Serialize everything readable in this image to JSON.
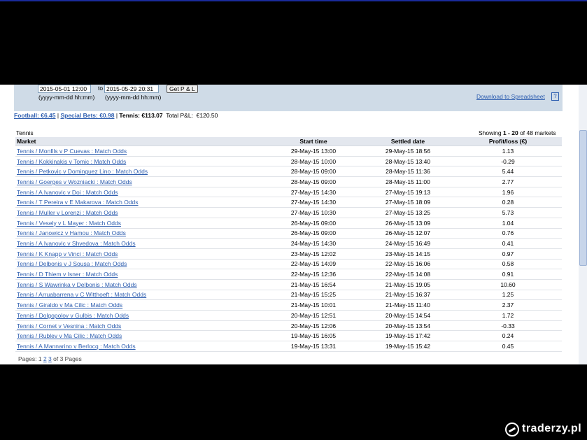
{
  "filter": {
    "from_value": "2015-05-01 12:00",
    "to_label": "to",
    "to_value": "2015-05-29 20:31",
    "from_hint": "(yyyy-mm-dd hh:mm)",
    "to_hint": "(yyyy-mm-dd hh:mm)",
    "get_pl_label": "Get P & L",
    "download_label": "Download to Spreadsheet",
    "help_label": "?"
  },
  "totals": {
    "football": "Football: €6.45",
    "sep1": " | ",
    "special": "Special Bets: €0.98",
    "sep2": " | ",
    "tennis": "Tennis: €113.07",
    "total": "  Total P&L:  €120.50"
  },
  "section_title": "Tennis",
  "showing": {
    "prefix": "Showing ",
    "range": "1 - 20",
    "suffix": " of 48 markets"
  },
  "table": {
    "headers": {
      "market": "Market",
      "start": "Start time",
      "settled": "Settled date",
      "pl": "Profit/loss (€)"
    },
    "rows": [
      {
        "market": "Tennis / Monfils v P Cuevas : Match Odds",
        "start": "29-May-15 13:00",
        "settled": "29-May-15 18:56",
        "pl": "1.13"
      },
      {
        "market": "Tennis / Kokkinakis v Tomic : Match Odds",
        "start": "28-May-15 10:00",
        "settled": "28-May-15 13:40",
        "pl": "-0.29"
      },
      {
        "market": "Tennis / Petkovic v Dominguez Lino : Match Odds",
        "start": "28-May-15 09:00",
        "settled": "28-May-15 11:36",
        "pl": "5.44"
      },
      {
        "market": "Tennis / Goerges v Wozniacki : Match Odds",
        "start": "28-May-15 09:00",
        "settled": "28-May-15 11:00",
        "pl": "2.77"
      },
      {
        "market": "Tennis / A Ivanovic v Doi : Match Odds",
        "start": "27-May-15 14:30",
        "settled": "27-May-15 19:13",
        "pl": "1.96"
      },
      {
        "market": "Tennis / T Pereira v E Makarova : Match Odds",
        "start": "27-May-15 14:30",
        "settled": "27-May-15 18:09",
        "pl": "0.28"
      },
      {
        "market": "Tennis / Muller v Lorenzi : Match Odds",
        "start": "27-May-15 10:30",
        "settled": "27-May-15 13:25",
        "pl": "5.73"
      },
      {
        "market": "Tennis / Vesely v L Mayer : Match Odds",
        "start": "26-May-15 09:00",
        "settled": "26-May-15 13:09",
        "pl": "1.04"
      },
      {
        "market": "Tennis / Janowicz v Hamou : Match Odds",
        "start": "26-May-15 09:00",
        "settled": "26-May-15 12:07",
        "pl": "0.76"
      },
      {
        "market": "Tennis / A Ivanovic v Shvedova : Match Odds",
        "start": "24-May-15 14:30",
        "settled": "24-May-15 16:49",
        "pl": "0.41"
      },
      {
        "market": "Tennis / K Knapp v Vinci : Match Odds",
        "start": "23-May-15 12:02",
        "settled": "23-May-15 14:15",
        "pl": "0.97"
      },
      {
        "market": "Tennis / Delbonis v J Sousa : Match Odds",
        "start": "22-May-15 14:09",
        "settled": "22-May-15 16:06",
        "pl": "0.58"
      },
      {
        "market": "Tennis / D Thiem v Isner : Match Odds",
        "start": "22-May-15 12:36",
        "settled": "22-May-15 14:08",
        "pl": "0.91"
      },
      {
        "market": "Tennis / S Wawrinka v Delbonis : Match Odds",
        "start": "21-May-15 16:54",
        "settled": "21-May-15 19:05",
        "pl": "10.60"
      },
      {
        "market": "Tennis / Arruabarrena v C Witthoeft : Match Odds",
        "start": "21-May-15 15:25",
        "settled": "21-May-15 16:37",
        "pl": "1.25"
      },
      {
        "market": "Tennis / Giraldo v Ma Cilic : Match Odds",
        "start": "21-May-15 10:01",
        "settled": "21-May-15 11:40",
        "pl": "2.37"
      },
      {
        "market": "Tennis / Dolgopolov v Gulbis : Match Odds",
        "start": "20-May-15 12:51",
        "settled": "20-May-15 14:54",
        "pl": "1.72"
      },
      {
        "market": "Tennis / Cornet v Vesnina : Match Odds",
        "start": "20-May-15 12:06",
        "settled": "20-May-15 13:54",
        "pl": "-0.33"
      },
      {
        "market": "Tennis / Rublev v Ma Cilic : Match Odds",
        "start": "19-May-15 16:05",
        "settled": "19-May-15 17:42",
        "pl": "0.24"
      },
      {
        "market": "Tennis / A Mannarino v Berlocq : Match Odds",
        "start": "19-May-15 13:31",
        "settled": "19-May-15 15:42",
        "pl": "0.45"
      }
    ]
  },
  "pagination": {
    "label": "Pages: ",
    "current": "1",
    "page2": "2",
    "page3": "3",
    "suffix": " of 3 Pages"
  },
  "watermark": "traderzy.pl"
}
